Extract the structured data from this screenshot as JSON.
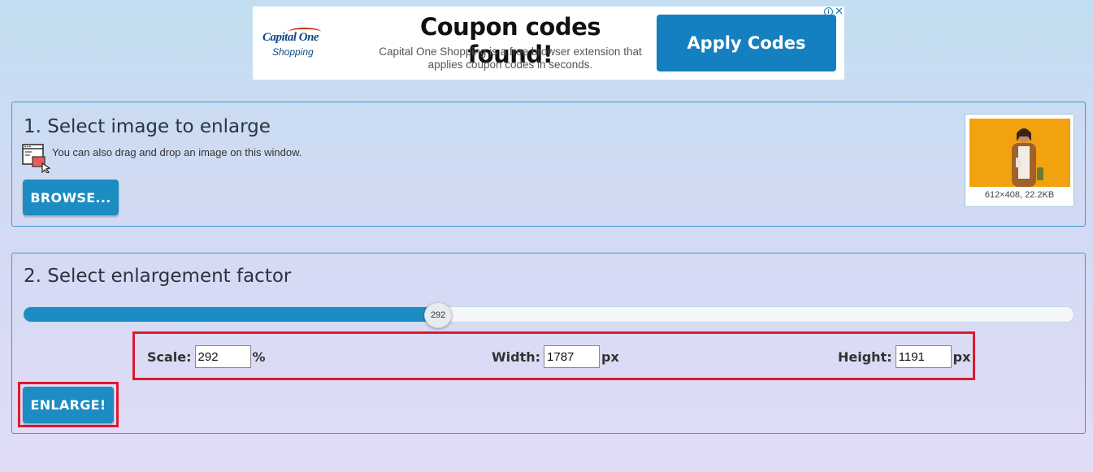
{
  "ad": {
    "brand": "Capital One",
    "brand_sub": "Shopping",
    "headline": "Coupon codes found!",
    "description": "Capital One Shopping is a free browser extension that applies coupon codes in seconds.",
    "cta_label": "Apply Codes",
    "info_icon": "i",
    "close_icon": "✕"
  },
  "step1": {
    "title": "1. Select image to enlarge",
    "hint": "You can also drag and drop an image on this window.",
    "browse_label": "BROWSE...",
    "thumbnail_caption": "612×408, 22.2KB"
  },
  "step2": {
    "title": "2. Select enlargement factor",
    "slider_value": "292",
    "slider_fraction": 0.395,
    "scale_label": "Scale:",
    "scale_value": "292",
    "scale_unit": "%",
    "width_label": "Width:",
    "width_value": "1787",
    "width_unit": "px",
    "height_label": "Height:",
    "height_value": "1191",
    "height_unit": "px",
    "enlarge_label": "ENLARGE!"
  },
  "colors": {
    "accent": "#1c8cc3",
    "highlight": "#e0182d",
    "panel_border": "#3d9ad0"
  }
}
